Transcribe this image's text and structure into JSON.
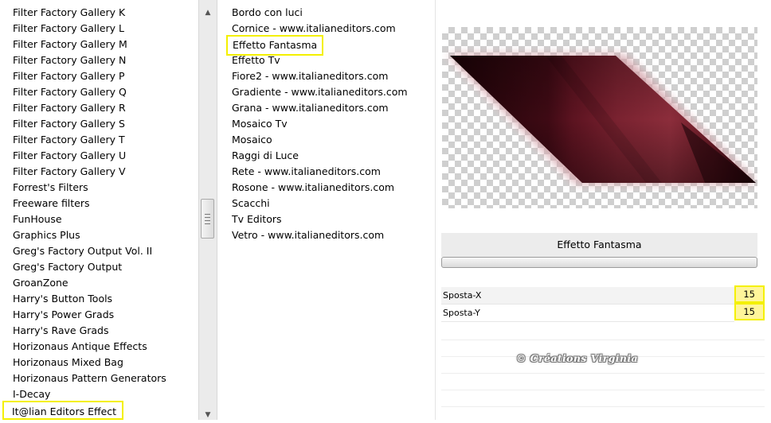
{
  "categories": {
    "items": [
      "Filter Factory Gallery K",
      "Filter Factory Gallery L",
      "Filter Factory Gallery M",
      "Filter Factory Gallery N",
      "Filter Factory Gallery P",
      "Filter Factory Gallery Q",
      "Filter Factory Gallery R",
      "Filter Factory Gallery S",
      "Filter Factory Gallery T",
      "Filter Factory Gallery U",
      "Filter Factory Gallery V",
      "Forrest's Filters",
      "Freeware filters",
      "FunHouse",
      "Graphics Plus",
      "Greg's Factory Output Vol. II",
      "Greg's Factory Output",
      "GroanZone",
      "Harry's Button Tools",
      "Harry's Power Grads",
      "Harry's Rave Grads",
      "Horizonaus Antique Effects",
      "Horizonaus Mixed Bag",
      "Horizonaus Pattern Generators",
      "I-Decay"
    ],
    "selected": "It@lian Editors Effect"
  },
  "scrollbar": {
    "up_icon": "arrow-up-icon",
    "down_icon": "arrow-down-icon"
  },
  "filters": {
    "items": [
      "Bordo con luci",
      "Cornice - www.italianeditors.com",
      "Effetto Fantasma",
      "Effetto Tv",
      "Fiore2 - www.italianeditors.com",
      "Gradiente - www.italianeditors.com",
      "Grana - www.italianeditors.com",
      "Mosaico Tv",
      "Mosaico",
      "Raggi di Luce",
      "Rete - www.italianeditors.com",
      "Rosone - www.italianeditors.com",
      "Scacchi",
      "Tv Editors",
      "Vetro - www.italianeditors.com"
    ],
    "selected_index": 2
  },
  "effect": {
    "title": "Effetto Fantasma",
    "params": [
      {
        "label": "Sposta-X",
        "value": "15"
      },
      {
        "label": "Sposta-Y",
        "value": "15"
      }
    ]
  },
  "watermark": "© Créations Virginia",
  "colors": {
    "highlight_border": "#f4f000",
    "value_fill": "#fff59a",
    "preview_dark": "#3a0a12",
    "preview_light": "#8a2a38"
  }
}
